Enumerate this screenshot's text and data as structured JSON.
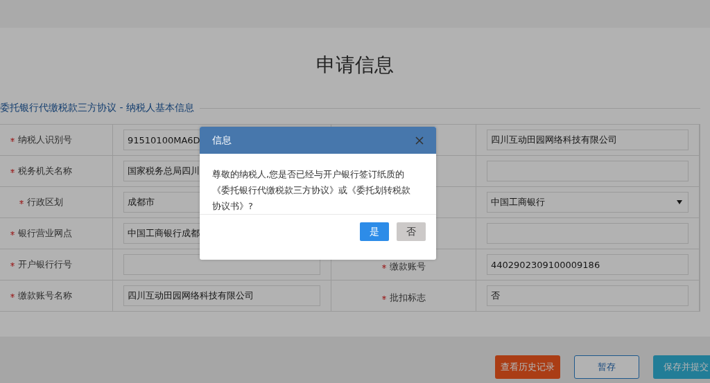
{
  "page_title": "申请信息",
  "section": {
    "legend": "委托银行代缴税款三方协议 - 纳税人基本信息",
    "rows": [
      {
        "left": {
          "label": "纳税人识别号",
          "required": true,
          "value": "91510100MA6D"
        },
        "right": {
          "kind": "input",
          "value": "四川互动田园网络科技有限公司"
        }
      },
      {
        "left": {
          "label": "税务机关名称",
          "required": true,
          "value": "国家税务总局四川"
        },
        "right": {
          "kind": "input"
        }
      },
      {
        "left": {
          "label": "行政区划",
          "required": true,
          "value": "成都市"
        },
        "right": {
          "kind": "select",
          "value": "中国工商银行"
        }
      },
      {
        "left": {
          "label": "银行营业网点",
          "required": true,
          "value": "中国工商银行成都"
        },
        "right": {
          "kind": "input"
        }
      },
      {
        "left": {
          "label": "开户银行行号",
          "required": true
        },
        "right": {
          "kind": "input",
          "label": "缴款账号",
          "required": true,
          "value": "4402902309100009186"
        }
      },
      {
        "left": {
          "label": "缴款账号名称",
          "required": true,
          "value": "四川互动田园网络科技有限公司"
        },
        "right": {
          "kind": "input",
          "label": "批扣标志",
          "required": true,
          "value": "否"
        }
      }
    ]
  },
  "actions": [
    {
      "label": "查看历史记录",
      "kind": "warning"
    },
    {
      "label": "暂存",
      "kind": "outline"
    },
    {
      "label": "保存并提交",
      "kind": "primary"
    }
  ],
  "dialog": {
    "title": "信息",
    "message": "尊敬的纳税人,您是否已经与开户银行签订纸质的《委托银行代缴税款三方协议》或《委托划转税款协议书》?",
    "buttons": [
      {
        "label": "是",
        "kind": "primary"
      },
      {
        "label": "否",
        "kind": "default"
      }
    ]
  }
}
